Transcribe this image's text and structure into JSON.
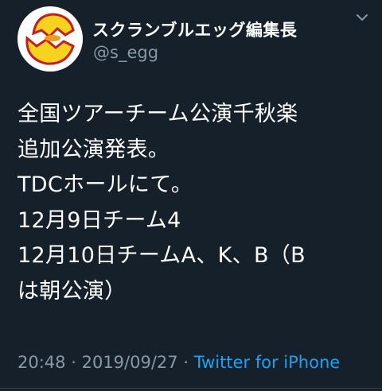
{
  "author": {
    "display_name": "スクランブルエッグ編集長",
    "handle": "@s_egg",
    "avatar_icon": "broken-egg-icon"
  },
  "tweet": {
    "lines": [
      "全国ツアーチーム公演千秋楽",
      "追加公演発表。",
      "TDCホールにて。",
      "12月9日チーム4",
      "12月10日チームA、K、B（B",
      "は朝公演）"
    ]
  },
  "meta": {
    "time": "20:48",
    "separator": "·",
    "date": "2019/09/27",
    "source": "Twitter for iPhone"
  },
  "menu_icon": "chevron-down-icon",
  "colors": {
    "background": "#15202b",
    "text": "#ffffff",
    "secondary": "#8899a6",
    "link": "#1da1f2"
  }
}
